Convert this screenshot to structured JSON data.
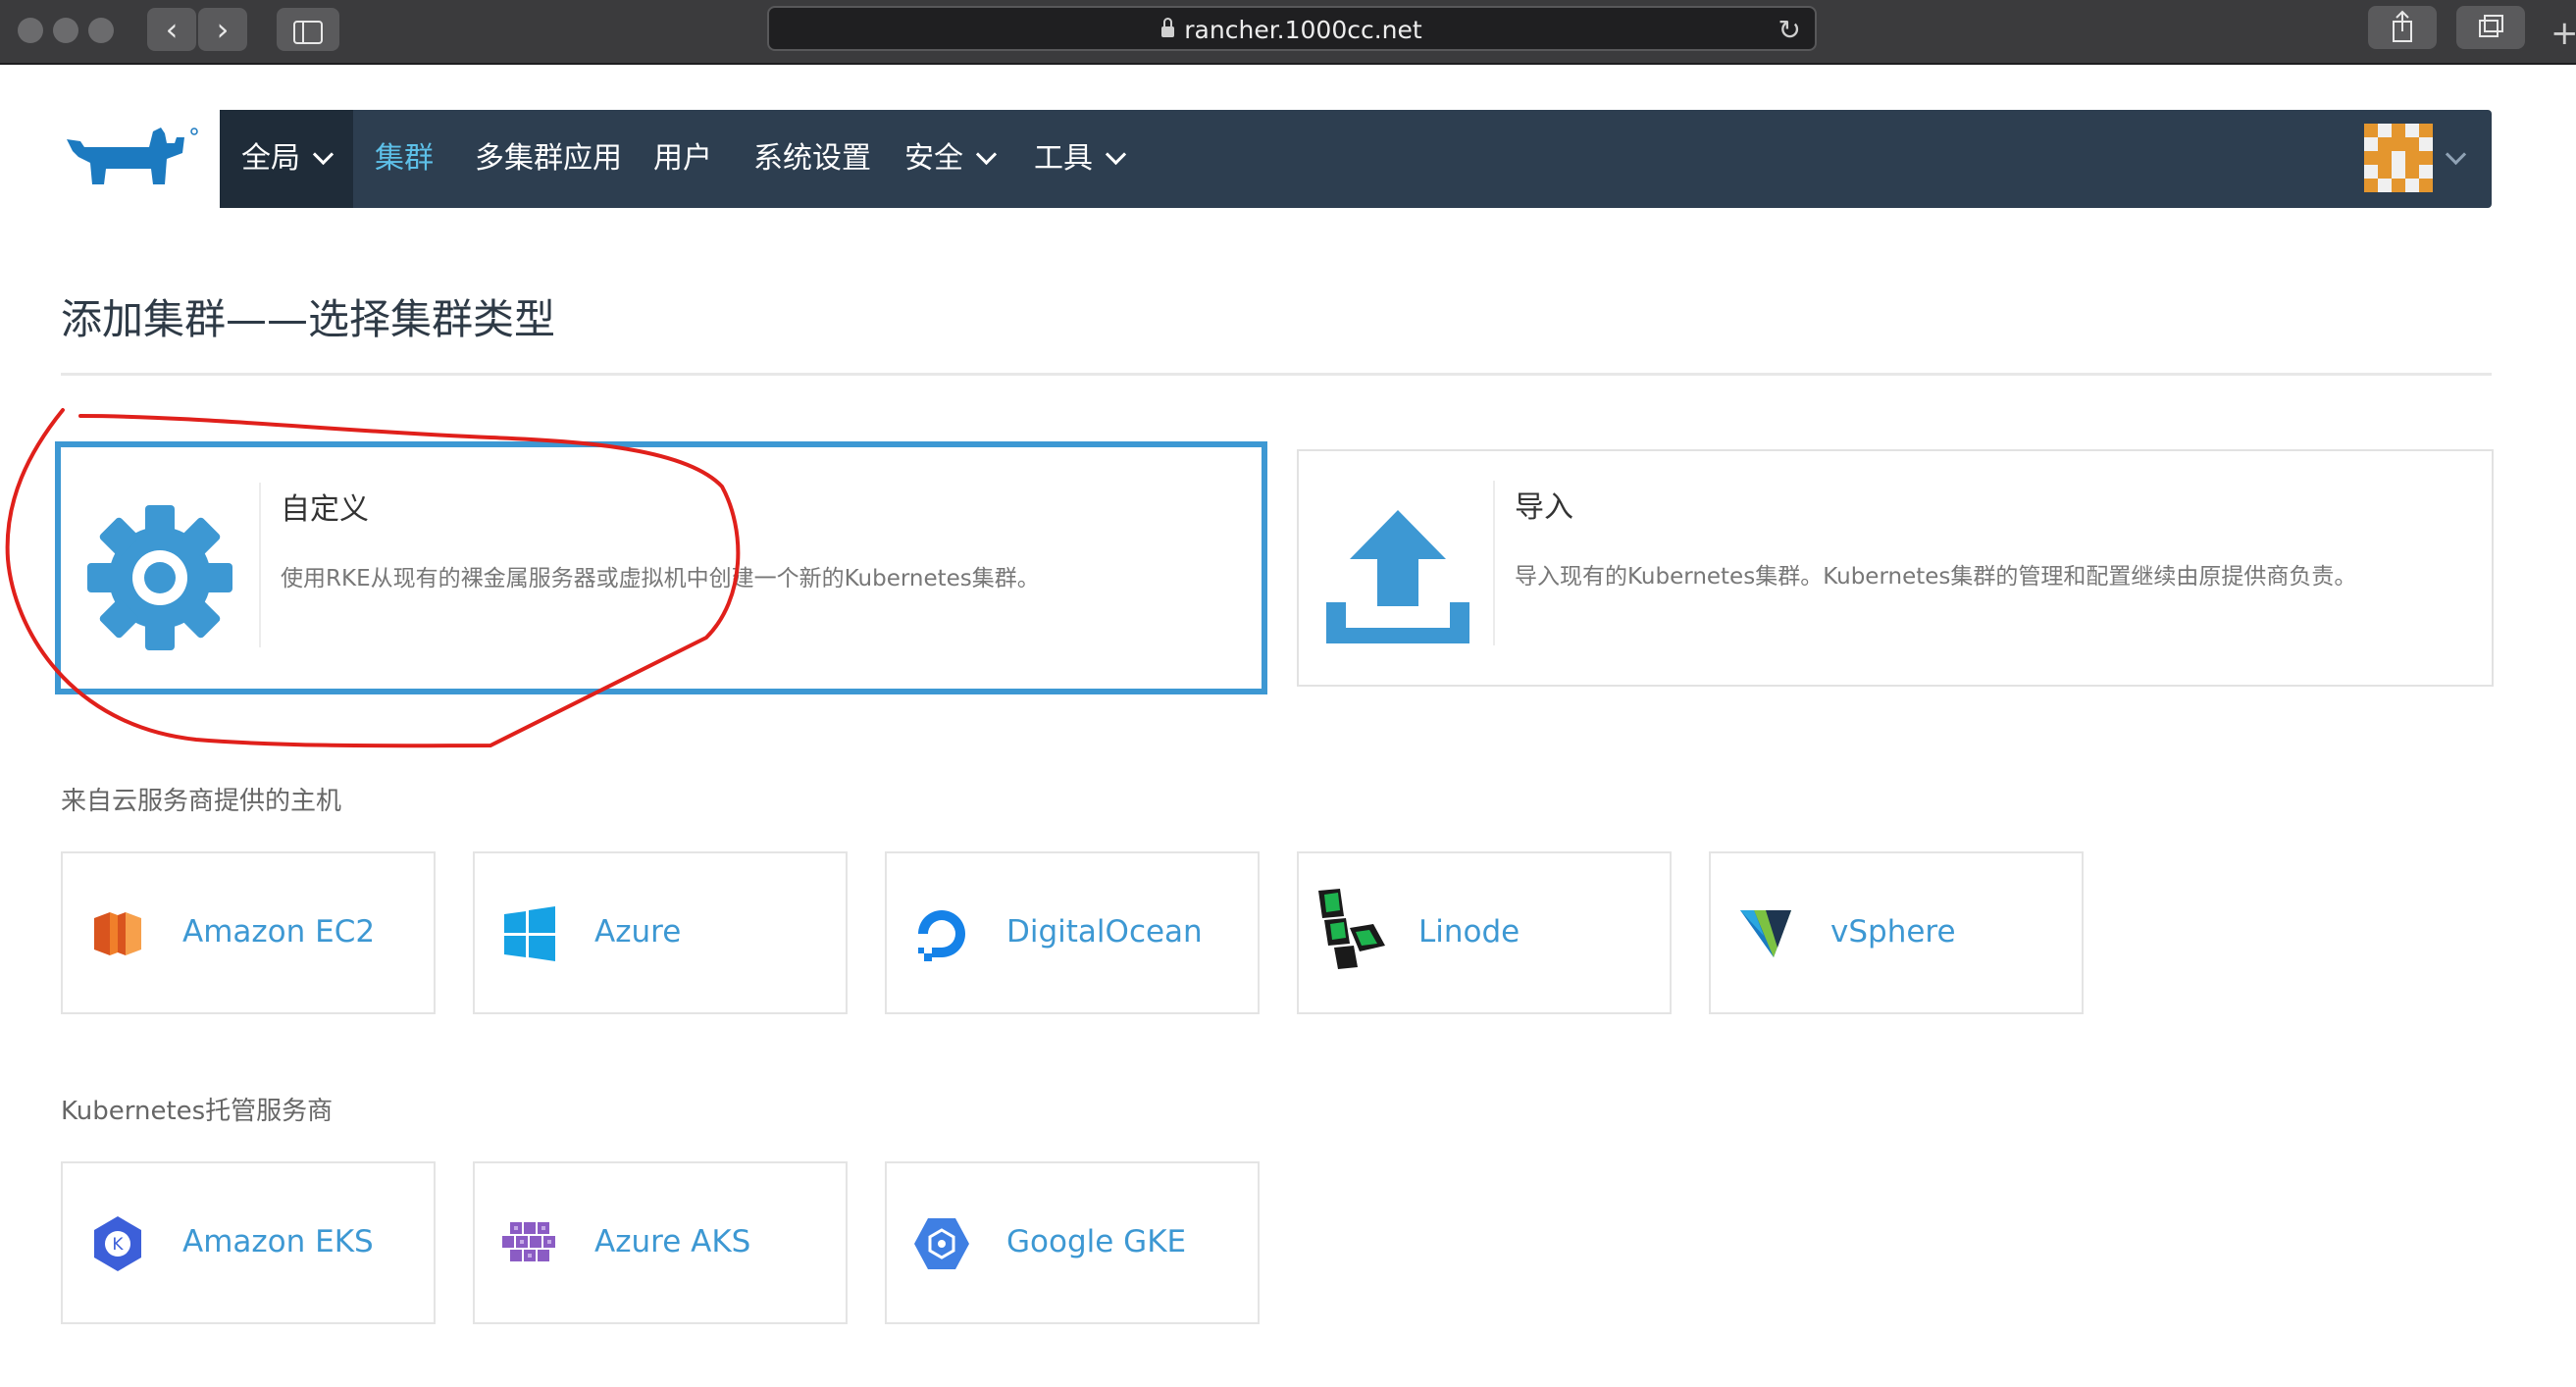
{
  "browser": {
    "url": "rancher.1000cc.net"
  },
  "nav": {
    "global": "全局",
    "items": [
      {
        "label": "集群",
        "active": true
      },
      {
        "label": "多集群应用",
        "active": false
      },
      {
        "label": "用户",
        "active": false
      },
      {
        "label": "系统设置",
        "active": false
      },
      {
        "label": "安全",
        "active": false
      },
      {
        "label": "工具",
        "active": false
      }
    ]
  },
  "page": {
    "title": "添加集群——选择集群类型"
  },
  "cards": {
    "custom": {
      "title": "自定义",
      "description": "使用RKE从现有的裸金属服务器或虚拟机中创建一个新的Kubernetes集群。"
    },
    "import": {
      "title": "导入",
      "description": "导入现有的Kubernetes集群。Kubernetes集群的管理和配置继续由原提供商负责。"
    }
  },
  "sections": {
    "cloud": {
      "label": "来自云服务商提供的主机",
      "tiles": [
        "Amazon EC2",
        "Azure",
        "DigitalOcean",
        "Linode",
        "vSphere"
      ]
    },
    "hosted": {
      "label": "Kubernetes托管服务商",
      "tiles": [
        "Amazon EKS",
        "Azure AKS",
        "Google GKE"
      ]
    }
  },
  "icons": {
    "custom": "gear-icon",
    "import": "upload-icon",
    "ec2": "amazon-ec2-icon",
    "azure": "azure-windows-icon",
    "digitalocean": "digitalocean-icon",
    "linode": "linode-icon",
    "vsphere": "vsphere-icon",
    "eks": "amazon-eks-icon",
    "aks": "azure-aks-icon",
    "gke": "google-gke-icon"
  },
  "colors": {
    "header_bg": "#2d3e50",
    "accent": "#3d98d3",
    "active_nav": "#5dc0e8",
    "annotation": "#e0201b"
  }
}
